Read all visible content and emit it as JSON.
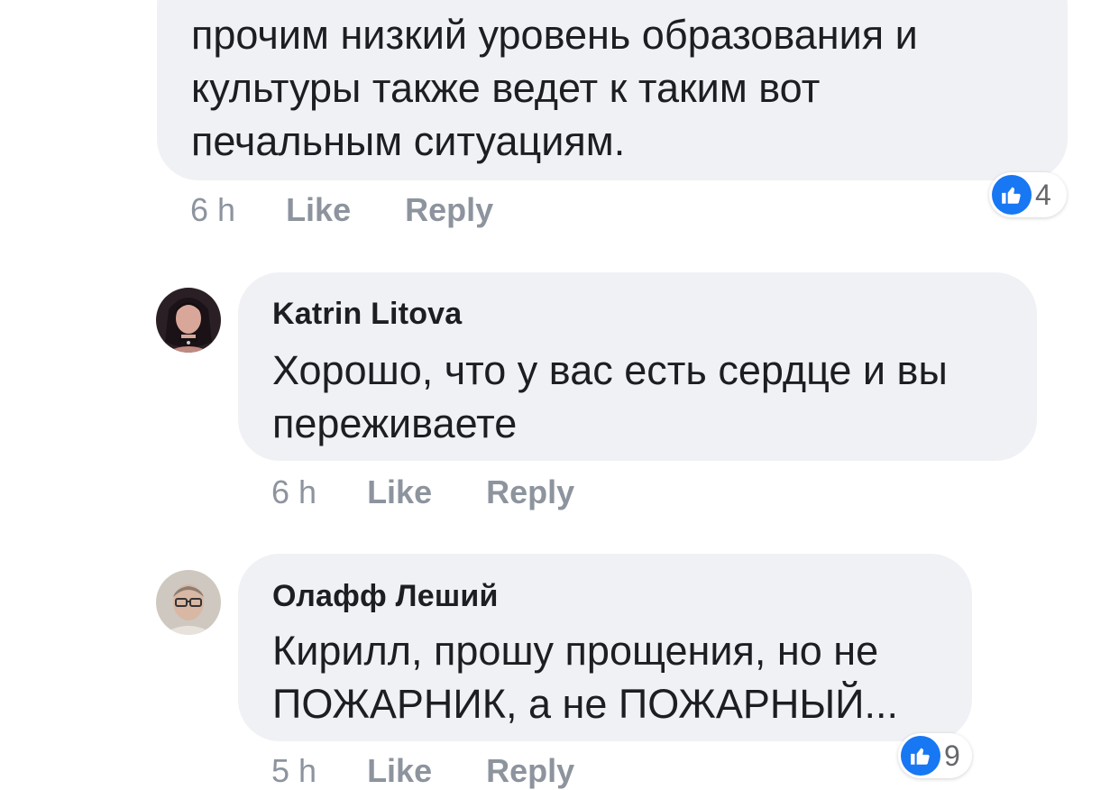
{
  "comment1": {
    "text_lines": [
      "прочим низкий уровень образования и",
      "культуры также ведет к таким вот",
      "печальным ситуациям."
    ],
    "time": "6 h",
    "like_label": "Like",
    "reply_label": "Reply",
    "reaction_count": "4"
  },
  "comment2": {
    "author": "Katrin Litova",
    "text_lines": [
      "Хорошо, что у вас есть сердце и вы",
      "переживаете"
    ],
    "time": "6 h",
    "like_label": "Like",
    "reply_label": "Reply"
  },
  "comment3": {
    "author": "Олафф Леший",
    "text_lines": [
      "Кирилл, прошу прощения, но не",
      "ПОЖАРНИК, а не ПОЖАРНЫЙ..."
    ],
    "time": "5 h",
    "like_label": "Like",
    "reply_label": "Reply",
    "reaction_count": "9"
  },
  "colors": {
    "bubble": "#f0f1f4",
    "meta_text": "#8d949e",
    "like_blue": "#1877f2"
  },
  "icons": [
    "thumbs-up-icon",
    "avatar-katrin",
    "avatar-olaff"
  ]
}
